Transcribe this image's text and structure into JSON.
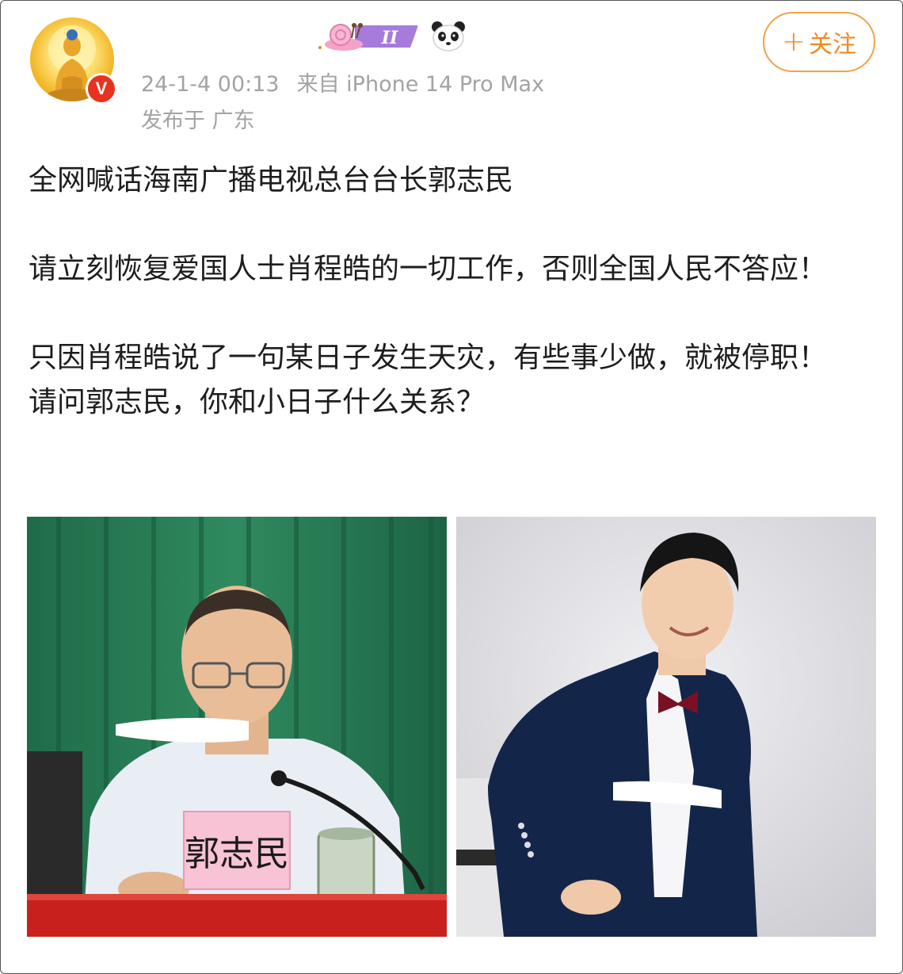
{
  "post": {
    "meta": {
      "timestamp": "24-1-4 00:13",
      "source": "来自 iPhone 14 Pro Max",
      "location": "发布于 广东"
    },
    "header": {
      "follow_label": "关注",
      "follow_icon": "plus-icon",
      "avatar_icon": "buddha-avatar",
      "verified_badge": "V",
      "badges": [
        "snail-level-badge",
        "panda-badge"
      ],
      "snail_badge_text": "II"
    },
    "content": {
      "line1": "全网喊话海南广播电视总台台长郭志民",
      "line2": "请立刻恢复爱国人士肖程皓的一切工作，否则全国人民不答应！",
      "line3": "只因肖程皓说了一句某日子发生天灾，有些事少做，就被停职！",
      "line4": "请问郭志民，你和小日子什么关系？"
    },
    "images": {
      "left_nameplate": "郭志民",
      "left_alt": "photo-official-at-podium",
      "right_alt": "photo-host-in-suit"
    },
    "colors": {
      "accent_orange": "#f08a24",
      "meta_gray": "#a3a3a3",
      "verified_red": "#e8321e"
    }
  }
}
